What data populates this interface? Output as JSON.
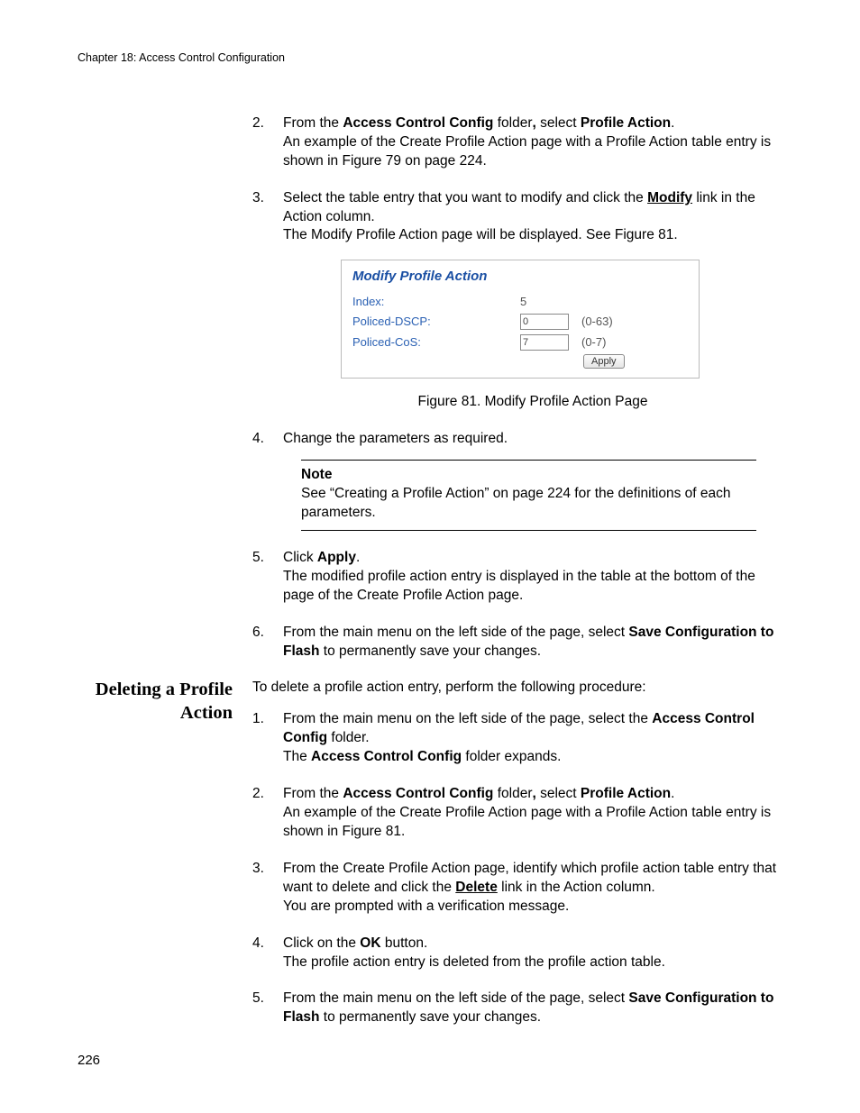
{
  "chapter": "Chapter 18: Access Control Configuration",
  "steps_a": {
    "s2_num": "2.",
    "s2_p1a": "From the ",
    "s2_p1b": "Access Control Config",
    "s2_p1c": " folder",
    "s2_comma": ",",
    "s2_p1d": " select ",
    "s2_p1e": "Profile Action",
    "s2_p1f": ".",
    "s2_l2": "An example of the Create Profile Action page with a Profile Action table entry is shown in Figure 79 on page 224.",
    "s3_num": "3.",
    "s3_l1a": "Select the table entry that you want to modify and click the ",
    "s3_l1b": "Modify",
    "s3_l1c": " link in the Action column.",
    "s3_l2": "The Modify Profile Action page will be displayed. See Figure 81."
  },
  "figure": {
    "title": "Modify Profile Action",
    "row1_label": "Index:",
    "row1_val": "5",
    "row2_label": "Policed-DSCP:",
    "row2_val": "0",
    "row2_range": "(0-63)",
    "row3_label": "Policed-CoS:",
    "row3_val": "7",
    "row3_range": "(0-7)",
    "apply": "Apply",
    "caption": "Figure 81. Modify Profile Action Page"
  },
  "steps_b": {
    "s4_num": "4.",
    "s4_l1": "Change the parameters as required.",
    "note_h": "Note",
    "note_body": "See “Creating a Profile Action” on page 224 for the definitions of each parameters.",
    "s5_num": "5.",
    "s5_l1a": "Click ",
    "s5_l1b": "Apply",
    "s5_l1c": ".",
    "s5_l2": "The modified profile action entry is displayed in the table at the bottom of the page of the Create Profile Action page.",
    "s6_num": "6.",
    "s6_l1a": "From the main menu on the left side of the page, select ",
    "s6_l1b": "Save Configuration to Flash",
    "s6_l1c": " to permanently save your changes."
  },
  "side_heading": "Deleting a Profile Action",
  "section2_intro": "To delete a profile action entry, perform the following procedure:",
  "steps_c": {
    "s1_num": "1.",
    "s1_l1a": "From the main menu on the left side of the page, select the ",
    "s1_l1b": "Access Control Config",
    "s1_l1c": " folder.",
    "s1_l2a": "The ",
    "s1_l2b": "Access Control Config",
    "s1_l2c": " folder expands.",
    "s2_num": "2.",
    "s2_l1a": "From the ",
    "s2_l1b": "Access Control Config",
    "s2_l1c": " folder",
    "s2_comma": ",",
    "s2_l1d": " select ",
    "s2_l1e": "Profile Action",
    "s2_l1f": ".",
    "s2_l2": "An example of the Create Profile Action page with a Profile Action table entry is shown in Figure 81.",
    "s3_num": "3.",
    "s3_l1a": "From the Create Profile Action page, identify which profile action table entry that want to delete and click the ",
    "s3_l1b": "Delete",
    "s3_l1c": " link in the Action column.",
    "s3_l2": "You are prompted with a verification message.",
    "s4_num": "4.",
    "s4_l1a": "Click on the ",
    "s4_l1b": "OK",
    "s4_l1c": " button.",
    "s4_l2": "The profile action entry is deleted from the profile action table.",
    "s5_num": "5.",
    "s5_l1a": "From the main menu on the left side of the page, select ",
    "s5_l1b": "Save Configuration to Flash",
    "s5_l1c": " to permanently save your changes."
  },
  "page_num": "226"
}
